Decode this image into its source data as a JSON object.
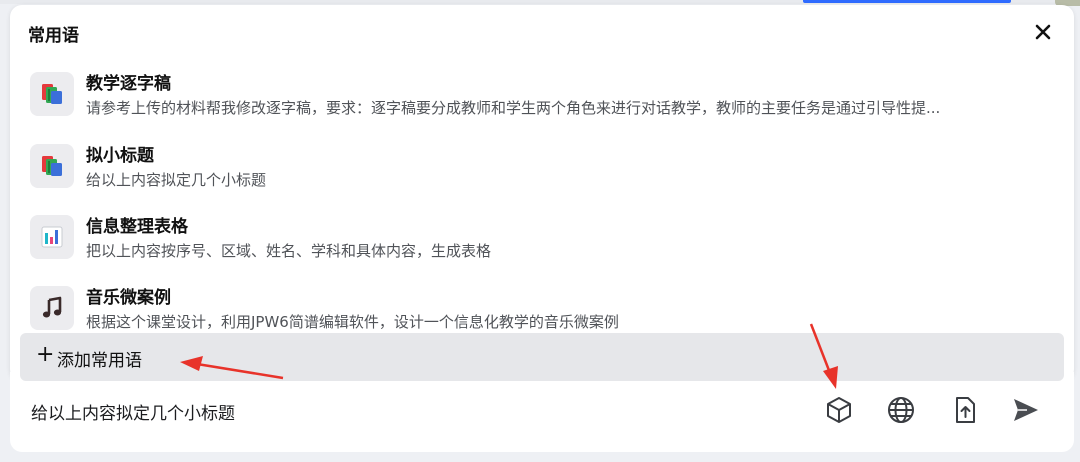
{
  "panel": {
    "title": "常用语",
    "items": [
      {
        "title": "教学逐字稿",
        "description": "请参考上传的材料帮我修改逐字稿，要求：逐字稿要分成教师和学生两个角色来进行对话教学，教师的主要任务是通过引导性提...",
        "icon": "books-icon"
      },
      {
        "title": "拟小标题",
        "description": "给以上内容拟定几个小标题",
        "icon": "books-icon"
      },
      {
        "title": "信息整理表格",
        "description": "把以上内容按序号、区域、姓名、学科和具体内容，生成表格",
        "icon": "bar-chart-icon"
      },
      {
        "title": "音乐微案例",
        "description": "根据这个课堂设计，利用JPW6简谱编辑软件，设计一个信息化教学的音乐微案例",
        "icon": "music-note-icon"
      }
    ],
    "add_label": "添加常用语",
    "add_plus": "+"
  },
  "input": {
    "value": "给以上内容拟定几个小标题"
  },
  "colors": {
    "accent": "#2f6bff",
    "annotation_arrow": "#e8332a"
  }
}
